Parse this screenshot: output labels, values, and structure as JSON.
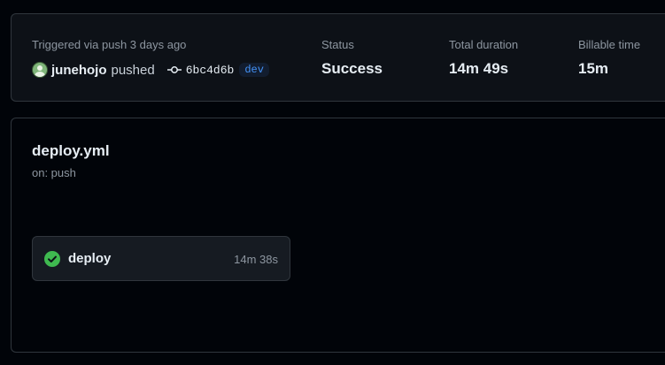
{
  "run_summary": {
    "trigger_text": "Triggered via push 3 days ago",
    "actor": "junehojo",
    "action": "pushed",
    "commit_sha": "6bc4d6b",
    "branch": "dev",
    "status_label": "Status",
    "status_value": "Success",
    "duration_label": "Total duration",
    "duration_value": "14m 49s",
    "billable_label": "Billable time",
    "billable_value": "15m"
  },
  "workflow": {
    "file": "deploy.yml",
    "on": "on: push",
    "jobs": [
      {
        "name": "deploy",
        "duration": "14m 38s",
        "status": "success",
        "icon": "check-circle-icon"
      }
    ]
  },
  "colors": {
    "success": "#3fb950",
    "branch_text": "#4493f8",
    "branch_bg": "#121d2f"
  }
}
